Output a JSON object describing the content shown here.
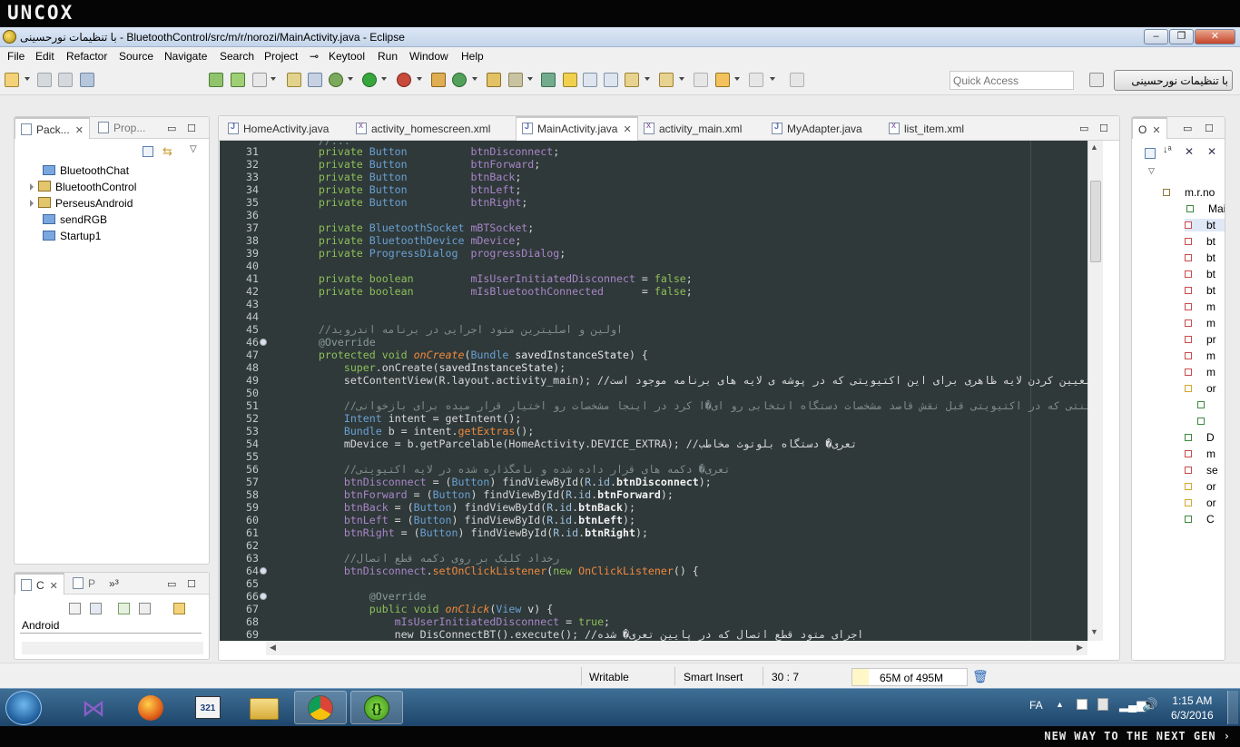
{
  "brand": {
    "logo": "UNCOX",
    "slogan": "NEW WAY TO THE NEXT GEN ›"
  },
  "window": {
    "title": "با تنظیمات نورحسینی - BluetoothControl/src/m/r/norozi/MainActivity.java - Eclipse",
    "minimize": "–",
    "restore": "❐",
    "close": "✕"
  },
  "menu": [
    "File",
    "Edit",
    "Refactor",
    "Source",
    "Navigate",
    "Search",
    "Project",
    "Keytool",
    "Run",
    "Window",
    "Help"
  ],
  "toolbar": {
    "quick_access_placeholder": "Quick Access",
    "perspective": "با تنظیمات نورحسینی"
  },
  "package_explorer": {
    "tabs": [
      {
        "label": "Pack..."
      },
      {
        "label": "Prop..."
      }
    ],
    "items": [
      {
        "label": "BluetoothChat",
        "type": "folder"
      },
      {
        "label": "BluetoothControl",
        "type": "project"
      },
      {
        "label": "PerseusAndroid",
        "type": "project"
      },
      {
        "label": "sendRGB",
        "type": "folder"
      },
      {
        "label": "Startup1",
        "type": "folder"
      }
    ]
  },
  "console": {
    "tabs": [
      {
        "label": "C"
      },
      {
        "label": "P"
      },
      {
        "label": "³"
      }
    ],
    "content": "Android"
  },
  "editor": {
    "tabs": [
      {
        "label": "HomeActivity.java",
        "icon": "java-file-icon"
      },
      {
        "label": "activity_homescreen.xml",
        "icon": "xml-file-icon"
      },
      {
        "label": "MainActivity.java",
        "icon": "java-file-icon",
        "active": true
      },
      {
        "label": "activity_main.xml",
        "icon": "xml-file-icon"
      },
      {
        "label": "MyAdapter.java",
        "icon": "java-file-icon"
      },
      {
        "label": "list_item.xml",
        "icon": "xml-file-icon"
      }
    ],
    "lines": [
      {
        "n": "31",
        "t": "    private Button          btnDisconnect;"
      },
      {
        "n": "32",
        "t": "    private Button          btnForward;"
      },
      {
        "n": "33",
        "t": "    private Button          btnBack;"
      },
      {
        "n": "34",
        "t": "    private Button          btnLeft;"
      },
      {
        "n": "35",
        "t": "    private Button          btnRight;"
      },
      {
        "n": "36",
        "t": ""
      },
      {
        "n": "37",
        "t": "    private BluetoothSocket mBTSocket;"
      },
      {
        "n": "38",
        "t": "    private BluetoothDevice mDevice;"
      },
      {
        "n": "39",
        "t": "    private ProgressDialog  progressDialog;"
      },
      {
        "n": "40",
        "t": ""
      },
      {
        "n": "41",
        "t": "    private boolean         mIsUserInitiatedDisconnect = false;"
      },
      {
        "n": "42",
        "t": "    private boolean         mIsBluetoothConnected      = false;"
      },
      {
        "n": "43",
        "t": ""
      },
      {
        "n": "44",
        "t": ""
      },
      {
        "n": "45",
        "t": "    //اولین و اصلیترین متود اجرایی در برنامه اندروید"
      },
      {
        "n": "46",
        "t": "    @Override"
      },
      {
        "n": "47",
        "t": "    protected void onCreate(Bundle savedInstanceState) {"
      },
      {
        "n": "48",
        "t": "        super.onCreate(savedInstanceState);"
      },
      {
        "n": "49",
        "t": "        setContentView(R.layout.activity_main); //تعیین کردن لایه ظاهری برای این اکتیویتی که در پوشه ی لایه های برنامه موجود است"
      },
      {
        "n": "50",
        "t": ""
      },
      {
        "n": "51",
        "t": "        //اینتنتی که در اکتیویتی قبل نقش قاصد مشخصات دستگاه انتخابی رو ای�ا کرد در اینجا مشخصات رو اختیار قرار میده برای بازخوانی"
      },
      {
        "n": "52",
        "t": "        Intent intent = getIntent();"
      },
      {
        "n": "53",
        "t": "        Bundle b = intent.getExtras();"
      },
      {
        "n": "54",
        "t": "        mDevice = b.getParcelable(HomeActivity.DEVICE_EXTRA); //تعری� دستگاه بلوتوث مخاطب"
      },
      {
        "n": "55",
        "t": ""
      },
      {
        "n": "56",
        "t": "        //تعری� دکمه های قرار داده شده و نامگذاره شده در لایه اکتیویتی"
      },
      {
        "n": "57",
        "t": "        btnDisconnect = (Button) findViewById(R.id.btnDisconnect);"
      },
      {
        "n": "58",
        "t": "        btnForward = (Button) findViewById(R.id.btnForward);"
      },
      {
        "n": "59",
        "t": "        btnBack = (Button) findViewById(R.id.btnBack);"
      },
      {
        "n": "60",
        "t": "        btnLeft = (Button) findViewById(R.id.btnLeft);"
      },
      {
        "n": "61",
        "t": "        btnRight = (Button) findViewById(R.id.btnRight);"
      },
      {
        "n": "62",
        "t": ""
      },
      {
        "n": "63",
        "t": "        //رخداد کلیک بر روی دکمه قطع اتصال"
      },
      {
        "n": "64",
        "t": "        btnDisconnect.setOnClickListener(new OnClickListener() {"
      },
      {
        "n": "65",
        "t": ""
      },
      {
        "n": "66",
        "t": "            @Override"
      },
      {
        "n": "67",
        "t": "            public void onClick(View v) {"
      },
      {
        "n": "68",
        "t": "                mIsUserInitiatedDisconnect = true;"
      },
      {
        "n": "69",
        "t": "                new DisConnectBT().execute(); //اجرای متود قطع اتصال که در پایین تعری� شده"
      }
    ]
  },
  "outline": {
    "tab": "O",
    "items": [
      "m.r.no",
      "MainA",
      "bt",
      "bt",
      "bt",
      "bt",
      "bt",
      "m",
      "m",
      "pr",
      "m",
      "m",
      "or",
      "",
      "",
      "D",
      "m",
      "se",
      "or",
      "or",
      "C"
    ]
  },
  "status": {
    "writable": "Writable",
    "insert_mode": "Smart Insert",
    "position": "30 : 7",
    "heap": "65M of 495M"
  },
  "taskbar": {
    "lang": "FA",
    "time": "1:15 AM",
    "date": "6/3/2016"
  },
  "colors": {
    "editor_bg": "#2f3939",
    "keyword": "#8ebf5a",
    "type": "#6aa0d4",
    "field": "#a985c9",
    "comment": "#7f8c8d"
  }
}
